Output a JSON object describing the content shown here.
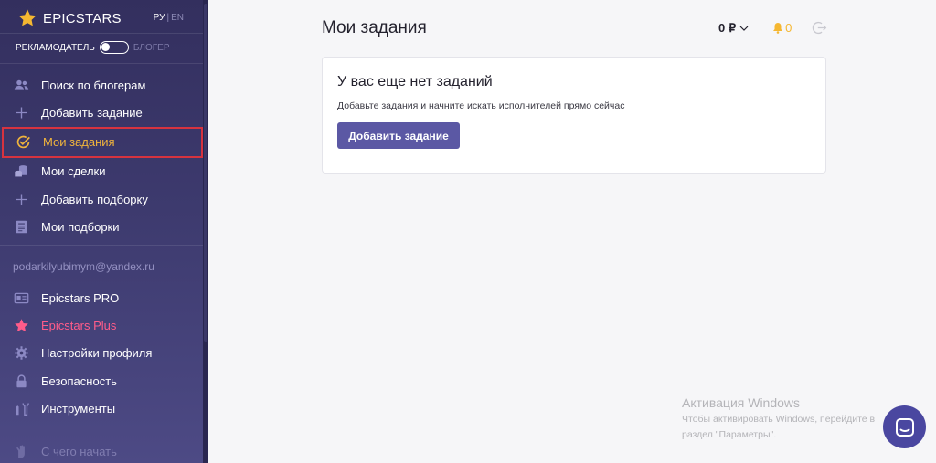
{
  "brand": {
    "name": "EPICSTARS",
    "lang_active": "РУ",
    "lang_inactive": "EN"
  },
  "role_toggle": {
    "left_label": "РЕКЛАМОДАТЕЛЬ",
    "right_label": "БЛОГЕР"
  },
  "sidebar": {
    "main_items": [
      {
        "label": "Поиск по блогерам",
        "icon": "users-icon"
      },
      {
        "label": "Добавить задание",
        "icon": "plus-icon"
      },
      {
        "label": "Мои задания",
        "icon": "check-circle-icon",
        "active": true
      },
      {
        "label": "Мои сделки",
        "icon": "coins-icon"
      },
      {
        "label": "Добавить подборку",
        "icon": "plus-icon"
      },
      {
        "label": "Мои подборки",
        "icon": "list-icon"
      }
    ],
    "email": "podarkilyubimym@yandex.ru",
    "account_items": [
      {
        "label": "Epicstars PRO",
        "icon": "id-card-icon"
      },
      {
        "label": "Epicstars Plus",
        "icon": "star-icon"
      },
      {
        "label": "Настройки профиля",
        "icon": "gear-icon"
      },
      {
        "label": "Безопасность",
        "icon": "lock-icon"
      },
      {
        "label": "Инструменты",
        "icon": "tools-icon"
      }
    ],
    "bottom_item": {
      "label": "С чего начать",
      "icon": "hand-icon"
    }
  },
  "header": {
    "title": "Мои задания",
    "balance": "0 ₽",
    "notifications_count": "0"
  },
  "empty_state": {
    "title": "У вас еще нет заданий",
    "subtitle": "Добавьте задания и начните искать исполнителей прямо сейчас",
    "button": "Добавить задание"
  },
  "watermark": {
    "title": "Активация Windows",
    "line1": "Чтобы активировать Windows, перейдите в",
    "line2": "раздел \"Параметры\"."
  },
  "colors": {
    "sidebar_bg": "#3d3a6e",
    "accent": "#5b58a4",
    "active_item": "#f0b43c",
    "active_border": "#d6333f",
    "plus": "#ff5c8a",
    "bell": "#f5b731"
  }
}
